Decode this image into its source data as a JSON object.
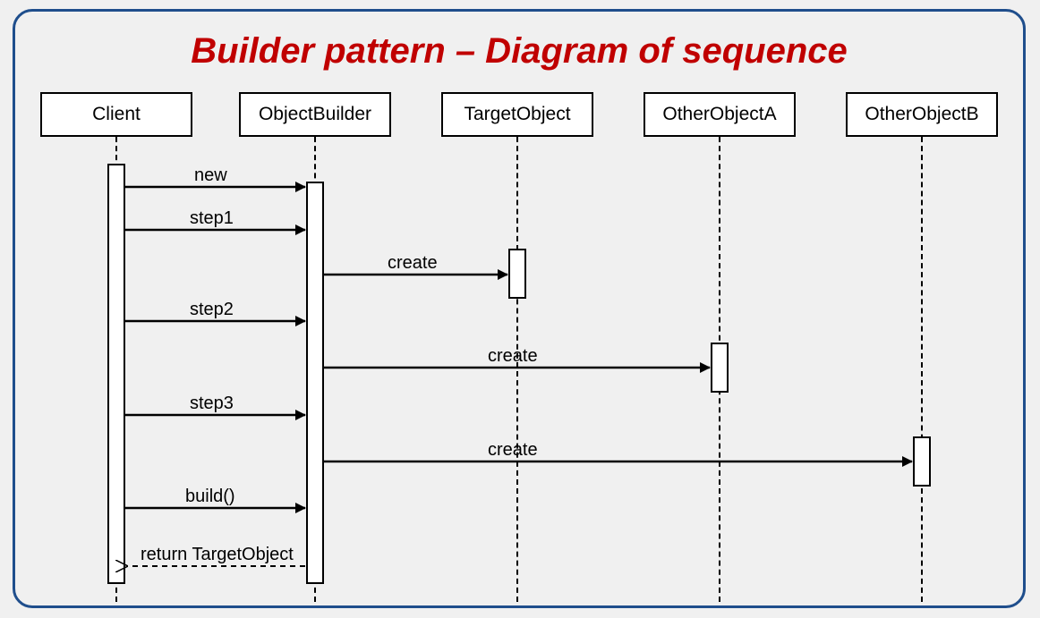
{
  "title": "Builder pattern – Diagram of sequence",
  "participants": {
    "client": "Client",
    "builder": "ObjectBuilder",
    "target": "TargetObject",
    "otherA": "OtherObjectA",
    "otherB": "OtherObjectB"
  },
  "messages": {
    "m_new": "new",
    "m_step1": "step1",
    "m_create1": "create",
    "m_step2": "step2",
    "m_create2": "create",
    "m_step3": "step3",
    "m_create3": "create",
    "m_build": "build()",
    "m_return": "return TargetObject"
  },
  "diagram_spec": {
    "type": "uml-sequence",
    "lifelines": [
      "Client",
      "ObjectBuilder",
      "TargetObject",
      "OtherObjectA",
      "OtherObjectB"
    ],
    "interactions": [
      {
        "from": "Client",
        "to": "ObjectBuilder",
        "label": "new",
        "kind": "sync"
      },
      {
        "from": "Client",
        "to": "ObjectBuilder",
        "label": "step1",
        "kind": "sync"
      },
      {
        "from": "ObjectBuilder",
        "to": "TargetObject",
        "label": "create",
        "kind": "sync"
      },
      {
        "from": "Client",
        "to": "ObjectBuilder",
        "label": "step2",
        "kind": "sync"
      },
      {
        "from": "ObjectBuilder",
        "to": "OtherObjectA",
        "label": "create",
        "kind": "sync"
      },
      {
        "from": "Client",
        "to": "ObjectBuilder",
        "label": "step3",
        "kind": "sync"
      },
      {
        "from": "ObjectBuilder",
        "to": "OtherObjectB",
        "label": "create",
        "kind": "sync"
      },
      {
        "from": "Client",
        "to": "ObjectBuilder",
        "label": "build()",
        "kind": "sync"
      },
      {
        "from": "ObjectBuilder",
        "to": "Client",
        "label": "return TargetObject",
        "kind": "return"
      }
    ]
  }
}
